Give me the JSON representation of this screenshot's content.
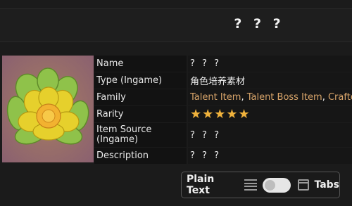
{
  "header": {
    "title": "? ? ?"
  },
  "item": {
    "image_icon": "golden-flower-icon",
    "rows": [
      {
        "key": "Name",
        "value": "? ? ?"
      },
      {
        "key": "Type (Ingame)",
        "value": "角色培养素材"
      },
      {
        "key": "Family",
        "values": [
          "Talent Item",
          "Talent Boss Item",
          "Crafted"
        ]
      },
      {
        "key": "Rarity",
        "stars": 5,
        "value": "★★★★★"
      },
      {
        "key": "Item Source (Ingame)",
        "value": "? ? ?"
      },
      {
        "key": "Description",
        "value": "? ? ?"
      }
    ]
  },
  "view_toggle": {
    "left_label": "Plain Text",
    "right_label": "Tabs",
    "left_icon": "list-lines-icon",
    "right_icon": "window-tabs-icon",
    "state": "plain-text"
  },
  "colors": {
    "link": "#d9a56a",
    "star": "#f0b23c",
    "background": "#1b1b1b"
  }
}
